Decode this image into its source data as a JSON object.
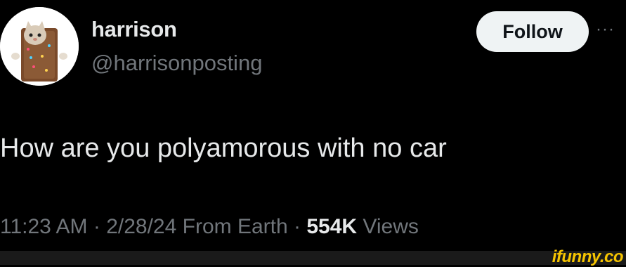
{
  "author": {
    "display_name": "harrison",
    "handle": "@harrisonposting",
    "avatar_icon": "cat-in-pop-tart-costume-avatar"
  },
  "actions": {
    "follow_label": "Follow",
    "more_icon": "more-horizontal-icon",
    "more_glyph": "···"
  },
  "tweet": {
    "text": "How are you polyamorous with no car"
  },
  "meta": {
    "time": "11:23 AM",
    "sep1": " · ",
    "date": "2/28/24",
    "source": " From Earth",
    "sep2": " · ",
    "views_count": "554K",
    "views_label": " Views"
  },
  "watermark": {
    "text": "ifunny.co",
    "color": "#f6c400"
  },
  "colors": {
    "background": "#000000",
    "primary_text": "#e7e9ea",
    "secondary_text": "#71767b",
    "follow_button_bg": "#eff3f4"
  }
}
